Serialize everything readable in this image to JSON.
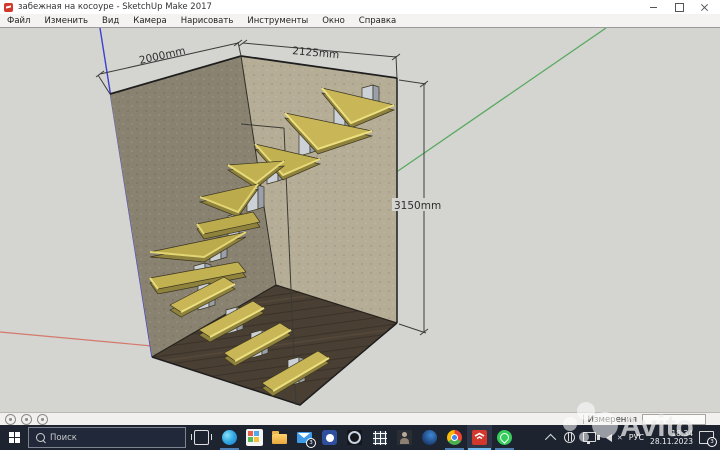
{
  "window": {
    "title": "забежная на косоуре - SketchUp Make 2017"
  },
  "menu": {
    "items": [
      "Файл",
      "Изменить",
      "Вид",
      "Камера",
      "Нарисовать",
      "Инструменты",
      "Окно",
      "Справка"
    ]
  },
  "scene": {
    "model": "winder staircase on mono stringer inside room corner",
    "dims": {
      "width_left": "2000mm",
      "width_right": "2125mm",
      "height": "3150mm"
    },
    "colors": {
      "sky": "#d4d4d1",
      "wall_left": "#8a8270",
      "wall_right": "#b6ad97",
      "floor": "#4a3f33",
      "tread_top": "#c9b757",
      "tread_edge_highlight": "#ecdf7f",
      "stringer": "#ccd1d8",
      "axis_red": "#d4796b",
      "axis_green": "#58aa60",
      "axis_blue": "#3f3fd0"
    }
  },
  "statusbar": {
    "left_icons": [
      "geolocation-icon",
      "credits-icon",
      "signin-icon"
    ],
    "measure_label": "Измерения",
    "measure_value": ""
  },
  "taskbar": {
    "search_placeholder": "Поиск",
    "language": "РУС",
    "time": "18:34",
    "date": "28.11.2023",
    "mail_badge": "3",
    "notification_badge": "3",
    "pinned_icons": [
      "edge",
      "store",
      "explorer",
      "mail",
      "messenger",
      "photos",
      "calculator",
      "contact",
      "browser",
      "chrome",
      "sketchup",
      "whatsapp"
    ]
  },
  "watermark": {
    "text": "Avito"
  }
}
